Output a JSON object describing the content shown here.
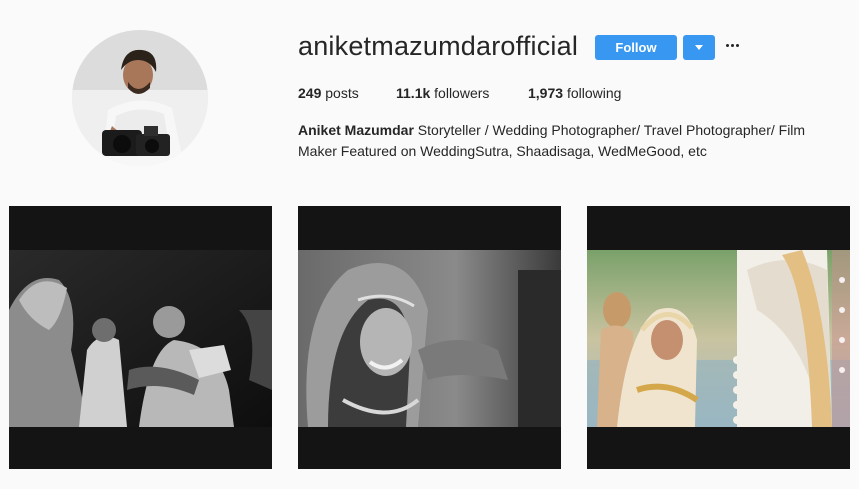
{
  "profile": {
    "username": "aniketmazumdarofficial",
    "follow_label": "Follow",
    "stats": {
      "posts_count": "249",
      "posts_label": "posts",
      "followers_count": "11.1k",
      "followers_label": "followers",
      "following_count": "1,973",
      "following_label": "following"
    },
    "bio": {
      "name": "Aniket Mazumdar",
      "text": " Storyteller / Wedding Photographer/ Travel Photographer/ Film Maker Featured on WeddingSutra, Shaadisaga, WedMeGood, etc"
    }
  },
  "icons": {
    "dropdown": "chevron-down-icon",
    "more": "more-options-icon"
  },
  "colors": {
    "background": "#fafafa",
    "accent": "#3897f0",
    "text": "#262626"
  },
  "posts": [
    {
      "style": "black-and-white"
    },
    {
      "style": "black-and-white"
    },
    {
      "style": "color"
    }
  ]
}
